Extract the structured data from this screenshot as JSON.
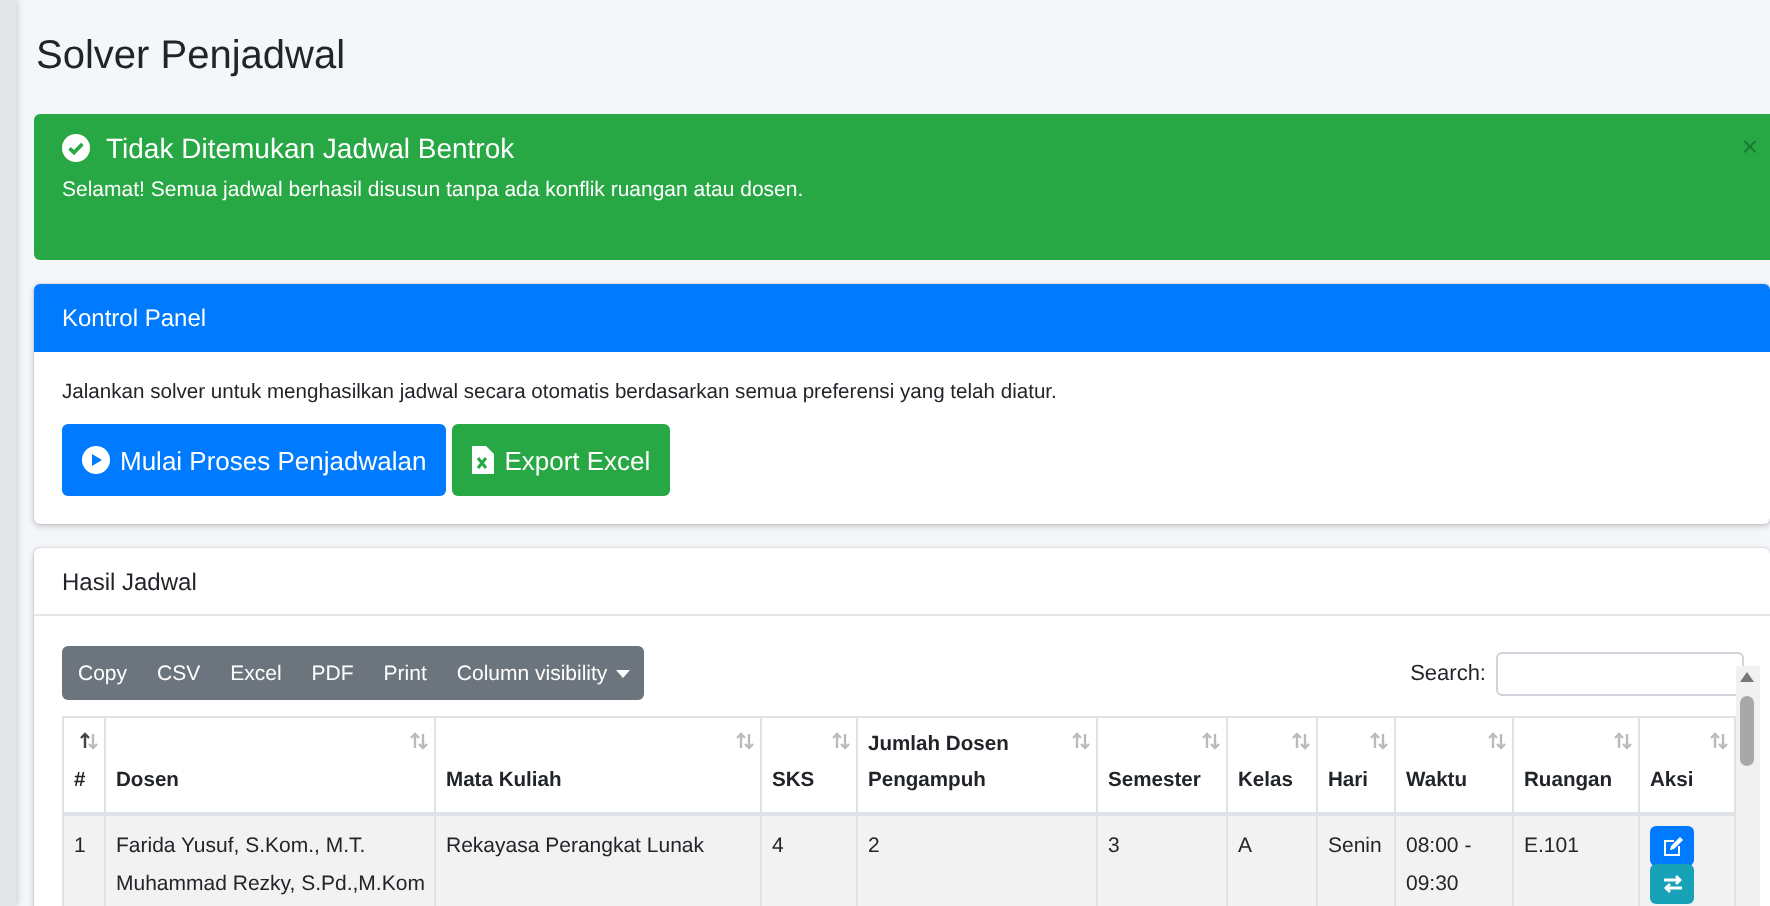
{
  "page": {
    "title": "Solver Penjadwal"
  },
  "alert": {
    "kind": "success",
    "title": "Tidak Ditemukan Jadwal Bentrok",
    "message": "Selamat! Semua jadwal berhasil disusun tanpa ada konflik ruangan atau dosen.",
    "close": "×"
  },
  "control_panel": {
    "title": "Kontrol Panel",
    "description": "Jalankan solver untuk menghasilkan jadwal secara otomatis berdasarkan semua preferensi yang telah diatur.",
    "buttons": [
      {
        "kind": "run",
        "label": "Mulai Proses Penjadwalan"
      },
      {
        "kind": "excel",
        "label": "Export Excel"
      }
    ]
  },
  "results": {
    "title": "Hasil Jadwal",
    "toolbar": [
      {
        "label": "Copy",
        "dropdown": false
      },
      {
        "label": "CSV",
        "dropdown": false
      },
      {
        "label": "Excel",
        "dropdown": false
      },
      {
        "label": "PDF",
        "dropdown": false
      },
      {
        "label": "Print",
        "dropdown": false
      },
      {
        "label": "Column visibility",
        "dropdown": true
      }
    ],
    "search": {
      "label": "Search:"
    },
    "columns": [
      {
        "label": "#",
        "sorted": true
      },
      {
        "label": "Dosen",
        "sorted": false
      },
      {
        "label": "Mata Kuliah",
        "sorted": false
      },
      {
        "label": "SKS",
        "sorted": false
      },
      {
        "label": "Jumlah Dosen Pengampuh",
        "sorted": false
      },
      {
        "label": "Semester",
        "sorted": false
      },
      {
        "label": "Kelas",
        "sorted": false
      },
      {
        "label": "Hari",
        "sorted": false
      },
      {
        "label": "Waktu",
        "sorted": false
      },
      {
        "label": "Ruangan",
        "sorted": false
      },
      {
        "label": "Aksi",
        "sorted": false
      }
    ],
    "rows": [
      {
        "cells": [
          "1",
          [
            "Farida Yusuf, S.Kom., M.T.",
            "Muhammad Rezky, S.Pd.,M.Kom"
          ],
          "Rekayasa Perangkat Lunak",
          "4",
          "2",
          "3",
          "A",
          "Senin",
          "08:00 - 09:30",
          "E.101"
        ],
        "actions": [
          {
            "kind": "edit"
          },
          {
            "kind": "swap"
          }
        ]
      }
    ]
  }
}
